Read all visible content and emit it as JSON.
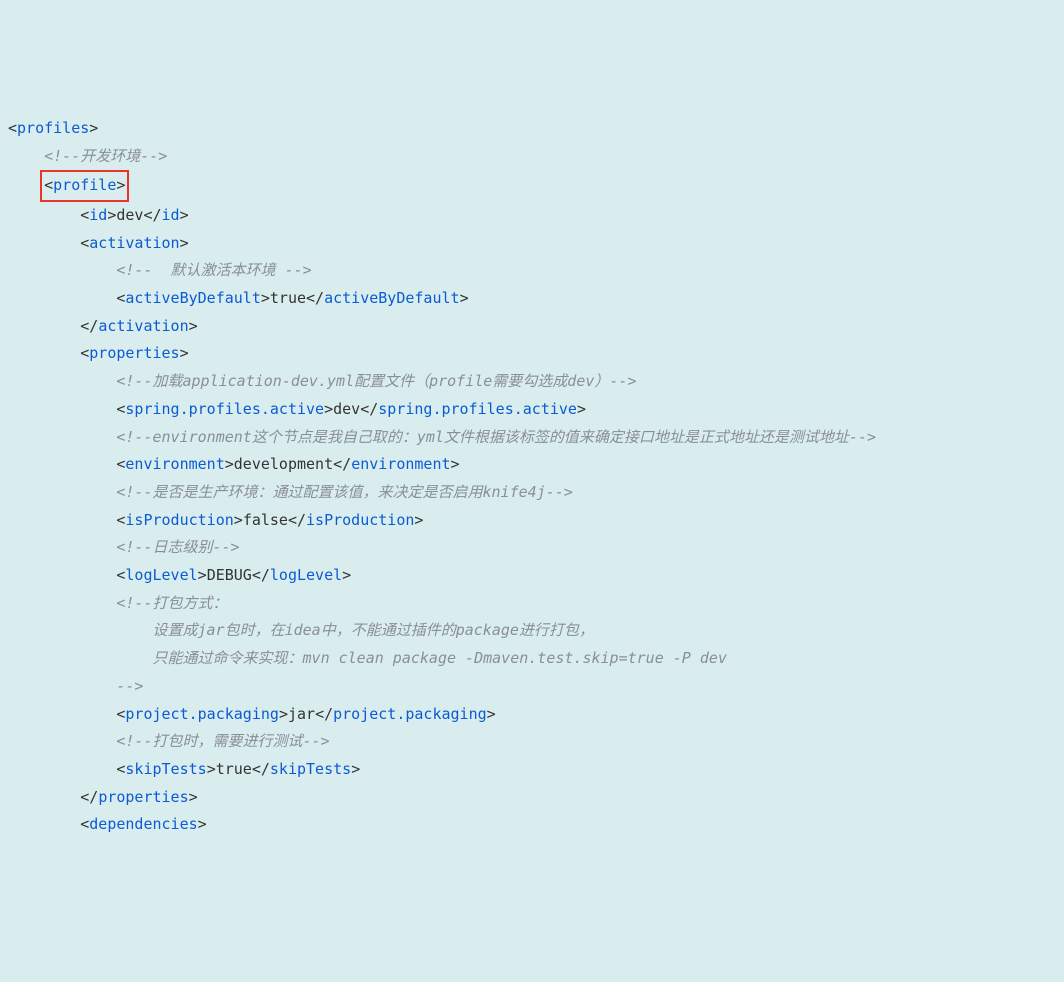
{
  "lines": [
    {
      "indent": 0,
      "type": "open",
      "tag": "profiles"
    },
    {
      "indent": 1,
      "type": "comment",
      "text": "<!--开发环境-->"
    },
    {
      "indent": 1,
      "type": "open",
      "tag": "profile",
      "highlighted": true
    },
    {
      "indent": 2,
      "type": "elem",
      "tag": "id",
      "value": "dev"
    },
    {
      "indent": 2,
      "type": "open",
      "tag": "activation"
    },
    {
      "indent": 3,
      "type": "comment",
      "text": "<!--  默认激活本环境 -->"
    },
    {
      "indent": 3,
      "type": "elem",
      "tag": "activeByDefault",
      "value": "true"
    },
    {
      "indent": 2,
      "type": "close",
      "tag": "activation"
    },
    {
      "indent": 2,
      "type": "open",
      "tag": "properties"
    },
    {
      "indent": 3,
      "type": "comment",
      "text": "<!--加载application-dev.yml配置文件（profile需要勾选成dev）-->"
    },
    {
      "indent": 3,
      "type": "elem",
      "tag": "spring.profiles.active",
      "value": "dev"
    },
    {
      "indent": 3,
      "type": "comment",
      "text": "<!--environment这个节点是我自己取的：yml文件根据该标签的值来确定接口地址是正式地址还是测试地址-->"
    },
    {
      "indent": 3,
      "type": "elem",
      "tag": "environment",
      "value": "development"
    },
    {
      "indent": 3,
      "type": "comment",
      "text": "<!--是否是生产环境：通过配置该值，来决定是否启用knife4j-->"
    },
    {
      "indent": 3,
      "type": "elem",
      "tag": "isProduction",
      "value": "false"
    },
    {
      "indent": 3,
      "type": "comment",
      "text": "<!--日志级别-->"
    },
    {
      "indent": 3,
      "type": "elem",
      "tag": "logLevel",
      "value": "DEBUG"
    },
    {
      "indent": 3,
      "type": "comment",
      "text": "<!--打包方式："
    },
    {
      "indent": 4,
      "type": "comment_cont",
      "text": "设置成jar包时，在idea中，不能通过插件的package进行打包，"
    },
    {
      "indent": 4,
      "type": "comment_cont",
      "text": "只能通过命令来实现：mvn clean package -Dmaven.test.skip=true -P dev"
    },
    {
      "indent": 3,
      "type": "comment_cont",
      "text": "-->"
    },
    {
      "indent": 3,
      "type": "elem",
      "tag": "project.packaging",
      "value": "jar"
    },
    {
      "indent": 3,
      "type": "comment",
      "text": "<!--打包时，需要进行测试-->"
    },
    {
      "indent": 3,
      "type": "elem",
      "tag": "skipTests",
      "value": "true"
    },
    {
      "indent": 2,
      "type": "close",
      "tag": "properties"
    },
    {
      "indent": 2,
      "type": "open",
      "tag": "dependencies"
    }
  ],
  "ui": {
    "indent_unit": "    ",
    "lt": "<",
    "gt": ">",
    "slash": "/"
  }
}
